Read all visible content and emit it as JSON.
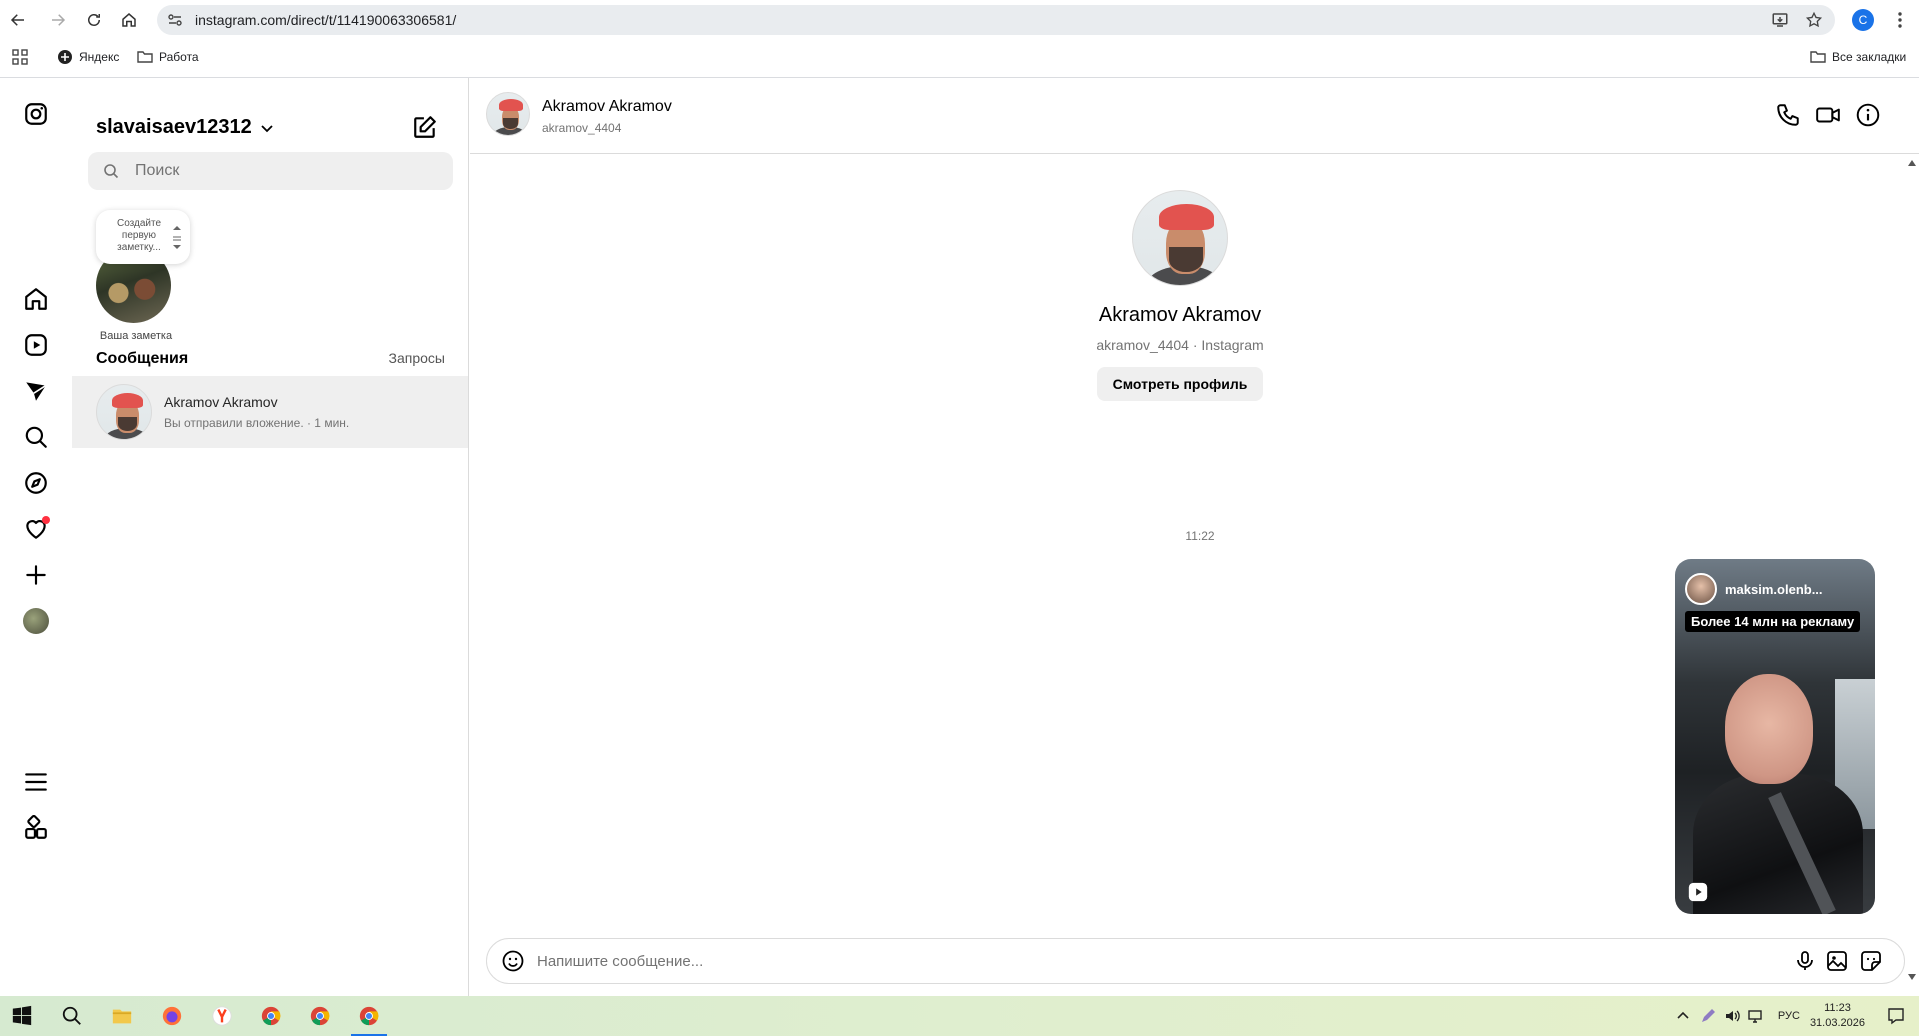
{
  "browser": {
    "url": "instagram.com/direct/t/114190063306581/",
    "profile_initial": "C",
    "bookmarks": [
      {
        "label": "Яндекс"
      },
      {
        "label": "Работа"
      }
    ],
    "all_bookmarks_label": "Все закладки"
  },
  "inbox": {
    "username": "slavaisaev12312",
    "search_placeholder": "Поиск",
    "note_bubble_text": "Создайте первую заметку...",
    "note_label": "Ваша заметка",
    "messages_title": "Сообщения",
    "requests_label": "Запросы",
    "threads": [
      {
        "name": "Akramov Akramov",
        "preview": "Вы отправили вложение. · 1 мин."
      }
    ]
  },
  "conversation": {
    "name": "Akramov Akramov",
    "username": "akramov_4404",
    "card_subtitle": "akramov_4404 · Instagram",
    "view_profile_label": "Смотреть профиль",
    "time_separator": "11:22",
    "reel": {
      "author": "maksim.olenb...",
      "banner": "Более 14 млн на рекламу"
    },
    "composer_placeholder": "Напишите сообщение..."
  },
  "taskbar": {
    "language": "РУС",
    "time": "11:23",
    "date": "31.03.2026"
  },
  "colors": {
    "notification_dot": "#ff3040",
    "search_bg": "#efefef",
    "selected_thread_bg": "#efefef",
    "profile_chip": "#1a73e8"
  }
}
